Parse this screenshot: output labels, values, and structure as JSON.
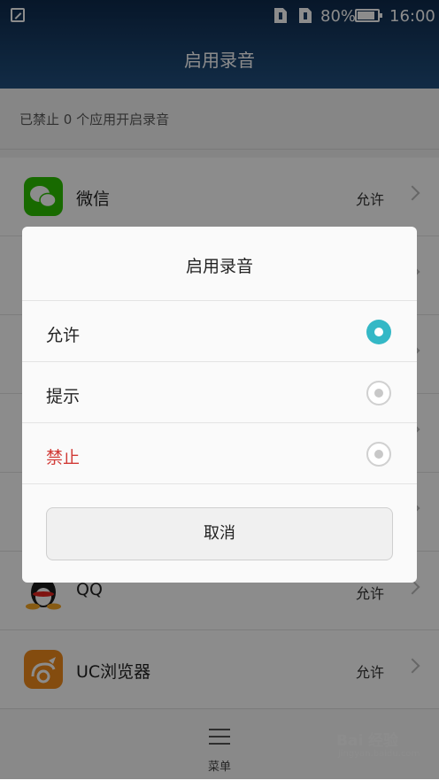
{
  "status_bar": {
    "battery": "80%",
    "time": "16:00",
    "battery_level": 0.8
  },
  "header": {
    "title": "启用录音"
  },
  "summary": {
    "text": "已禁止 0 个应用开启录音"
  },
  "apps": [
    {
      "name": "微信",
      "status": "允许",
      "icon": "wechat-icon",
      "color": "#2dc100"
    },
    {
      "name": "",
      "status": "",
      "icon": "app-icon",
      "color": "#9a9a9a"
    },
    {
      "name": "",
      "status": "",
      "icon": "app-icon",
      "color": "#9a9a9a"
    },
    {
      "name": "",
      "status": "",
      "icon": "app-icon",
      "color": "#9a9a9a"
    },
    {
      "name": "",
      "status": "",
      "icon": "app-icon",
      "color": "#9a9a9a"
    },
    {
      "name": "QQ",
      "status": "允许",
      "icon": "qq-icon",
      "color": "#1b1b1b"
    },
    {
      "name": "UC浏览器",
      "status": "允许",
      "icon": "uc-browser-icon",
      "color": "#f08a1c"
    }
  ],
  "bottom_bar": {
    "menu_label": "菜单"
  },
  "watermark": {
    "brand": "Bai 经验",
    "site": "jingyan.baidu.com"
  },
  "dialog": {
    "title": "启用录音",
    "options": [
      {
        "label": "允许",
        "selected": true
      },
      {
        "label": "提示",
        "selected": false
      },
      {
        "label": "禁止",
        "selected": false
      }
    ],
    "cancel_label": "取消",
    "accent_color": "#34b8c6",
    "danger_color": "#d13a36"
  }
}
